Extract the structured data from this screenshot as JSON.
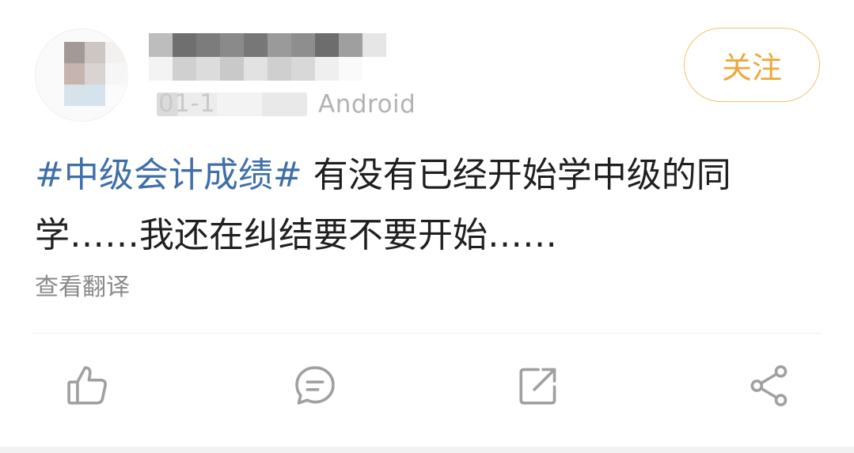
{
  "post": {
    "meta": {
      "date_visible": "01-1",
      "device": "Android"
    },
    "follow_label": "关注",
    "content": {
      "topic": "#中级会计成绩#",
      "text_line1": " 有没有已经开始学中级的同",
      "text_line2": "学……我还在纠结要不要开始……"
    },
    "translate_label": "查看翻译"
  },
  "actions": [
    {
      "name": "like",
      "icon": "thumbs-up-icon"
    },
    {
      "name": "comment",
      "icon": "comment-icon"
    },
    {
      "name": "repost",
      "icon": "repost-icon"
    },
    {
      "name": "share",
      "icon": "share-icon"
    }
  ],
  "colors": {
    "topic": "#3f6fa8",
    "follow": "#eea73d",
    "follow_border": "#f2c46a",
    "icon": "#a0a0a0"
  }
}
